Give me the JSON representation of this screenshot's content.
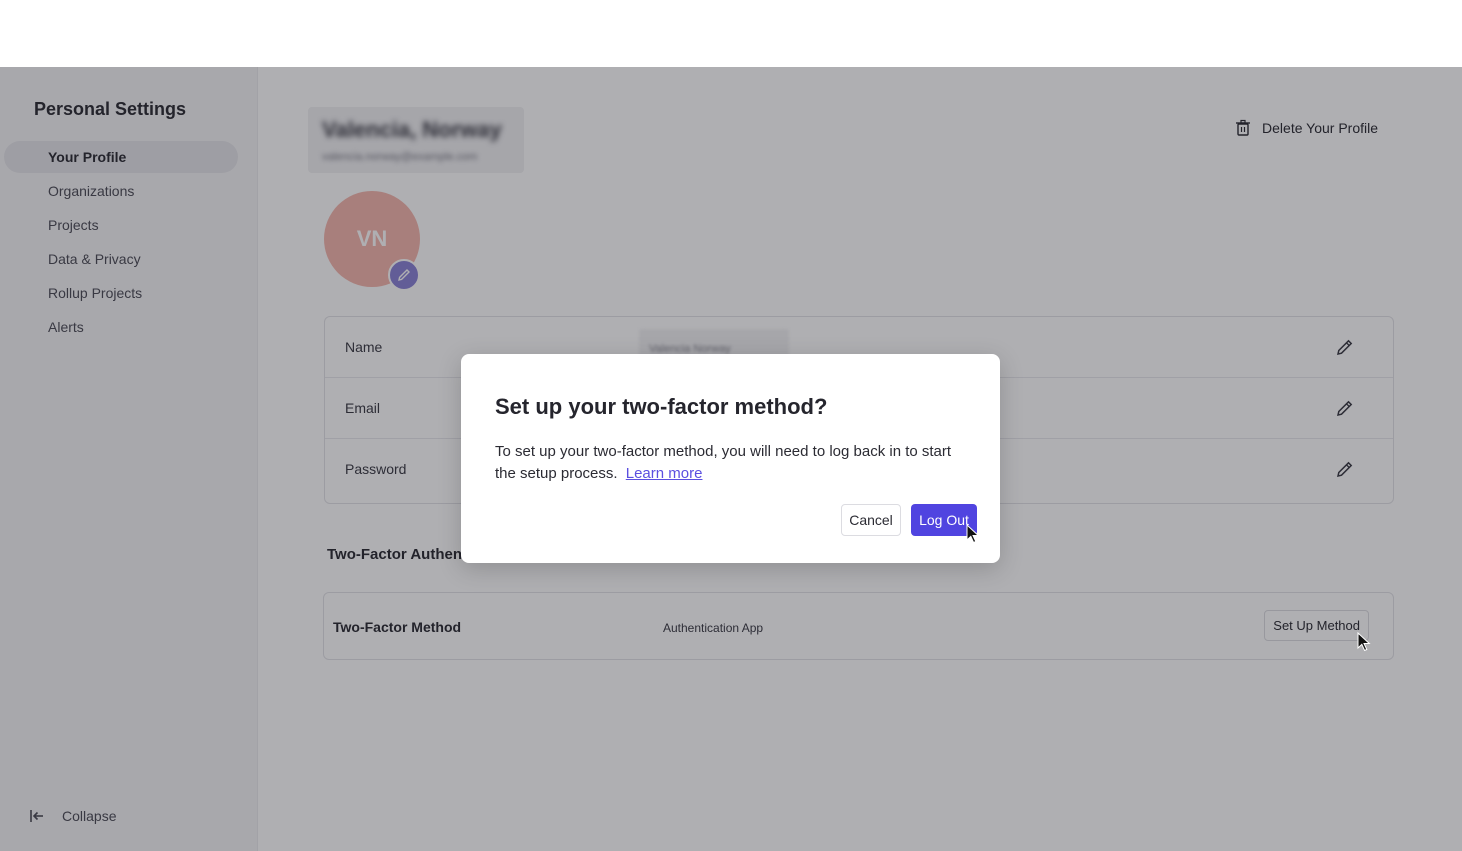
{
  "sidebar": {
    "title": "Personal Settings",
    "items": [
      {
        "label": "Your Profile",
        "active": true
      },
      {
        "label": "Organizations"
      },
      {
        "label": "Projects"
      },
      {
        "label": "Data & Privacy"
      },
      {
        "label": "Rollup Projects"
      },
      {
        "label": "Alerts"
      }
    ],
    "collapse_label": "Collapse",
    "collapse_icon": "collapse-left-icon"
  },
  "profile": {
    "name": "Valencia, Norway",
    "email": "valencia.norway@example.com",
    "initials": "VN",
    "avatar_color": "#f5b6ad",
    "delete_label": "Delete Your Profile",
    "delete_icon": "trash-icon",
    "fields": [
      {
        "label": "Name",
        "value": "Valencia Norway"
      },
      {
        "label": "Email",
        "value": ""
      },
      {
        "label": "Password",
        "value": ""
      }
    ]
  },
  "two_factor": {
    "heading": "Two-Factor Authentication",
    "row_label": "Two-Factor Method",
    "row_value": "Authentication App",
    "button_label": "Set Up Method"
  },
  "modal": {
    "title": "Set up your two-factor method?",
    "body": "To set up your two-factor method, you will need to log back in to start the setup process.",
    "link": "Learn more",
    "cancel_label": "Cancel",
    "logout_label": "Log Out",
    "accent_color": "#5044e0"
  }
}
